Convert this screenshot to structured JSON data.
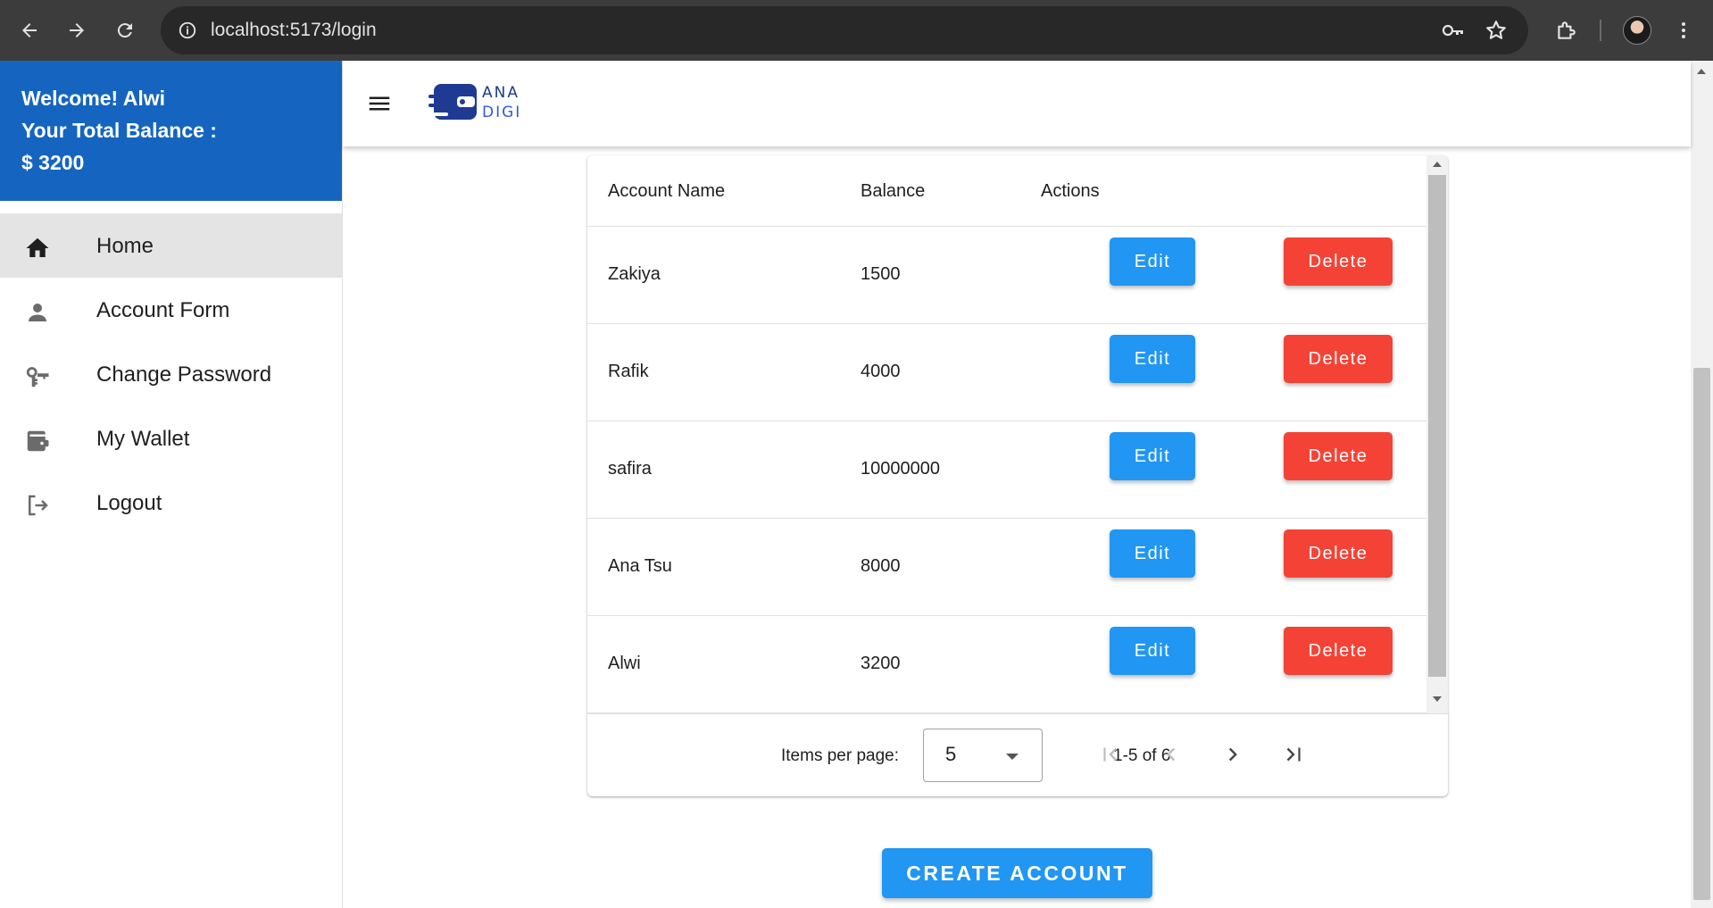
{
  "browser": {
    "url": "localhost:5173/login"
  },
  "sidebar": {
    "welcome": "Welcome! Alwi",
    "balance_label": "Your Total Balance :",
    "balance_value": "$ 3200",
    "items": [
      {
        "label": "Home",
        "icon": "home-icon",
        "active": true
      },
      {
        "label": "Account Form",
        "icon": "person-icon",
        "active": false
      },
      {
        "label": "Change Password",
        "icon": "key-icon",
        "active": false
      },
      {
        "label": "My Wallet",
        "icon": "wallet-icon",
        "active": false
      },
      {
        "label": "Logout",
        "icon": "logout-icon",
        "active": false
      }
    ]
  },
  "appbar": {
    "logo_top": "ANA",
    "logo_bottom": "DIGI"
  },
  "table": {
    "headers": [
      "Account Name",
      "Balance",
      "Actions"
    ],
    "rows": [
      {
        "name": "Zakiya",
        "balance": "1500",
        "edit": "Edit",
        "delete": "Delete"
      },
      {
        "name": "Rafik",
        "balance": "4000",
        "edit": "Edit",
        "delete": "Delete"
      },
      {
        "name": "safira",
        "balance": "10000000",
        "edit": "Edit",
        "delete": "Delete"
      },
      {
        "name": "Ana Tsu",
        "balance": "8000",
        "edit": "Edit",
        "delete": "Delete"
      },
      {
        "name": "Alwi",
        "balance": "3200",
        "edit": "Edit",
        "delete": "Delete"
      }
    ]
  },
  "paginator": {
    "items_per_page_label": "Items per page:",
    "items_per_page_value": "5",
    "range": "1-5 of 6"
  },
  "create_button": "CREATE ACCOUNT",
  "colors": {
    "primary": "#1565c0",
    "edit": "#2196f3",
    "delete": "#f44336"
  }
}
